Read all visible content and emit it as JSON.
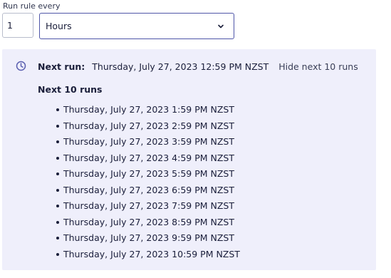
{
  "rule": {
    "label": "Run rule every",
    "interval_value": "1",
    "unit_value": "Hours",
    "chevron_icon": "chevron-down-icon"
  },
  "schedule": {
    "clock_icon": "clock-icon",
    "next_run_label": "Next run:",
    "next_run_value": "Thursday, July 27, 2023 12:59 PM NZST",
    "toggle_label": "Hide next 10 runs",
    "list_title": "Next 10 runs",
    "runs": [
      "Thursday, July 27, 2023 1:59 PM NZST",
      "Thursday, July 27, 2023 2:59 PM NZST",
      "Thursday, July 27, 2023 3:59 PM NZST",
      "Thursday, July 27, 2023 4:59 PM NZST",
      "Thursday, July 27, 2023 5:59 PM NZST",
      "Thursday, July 27, 2023 6:59 PM NZST",
      "Thursday, July 27, 2023 7:59 PM NZST",
      "Thursday, July 27, 2023 8:59 PM NZST",
      "Thursday, July 27, 2023 9:59 PM NZST",
      "Thursday, July 27, 2023 10:59 PM NZST"
    ]
  },
  "colors": {
    "panel_background": "#efeffb",
    "select_border": "#4f56a8",
    "icon_color": "#5a5fb0",
    "text": "#1a1e3a"
  }
}
